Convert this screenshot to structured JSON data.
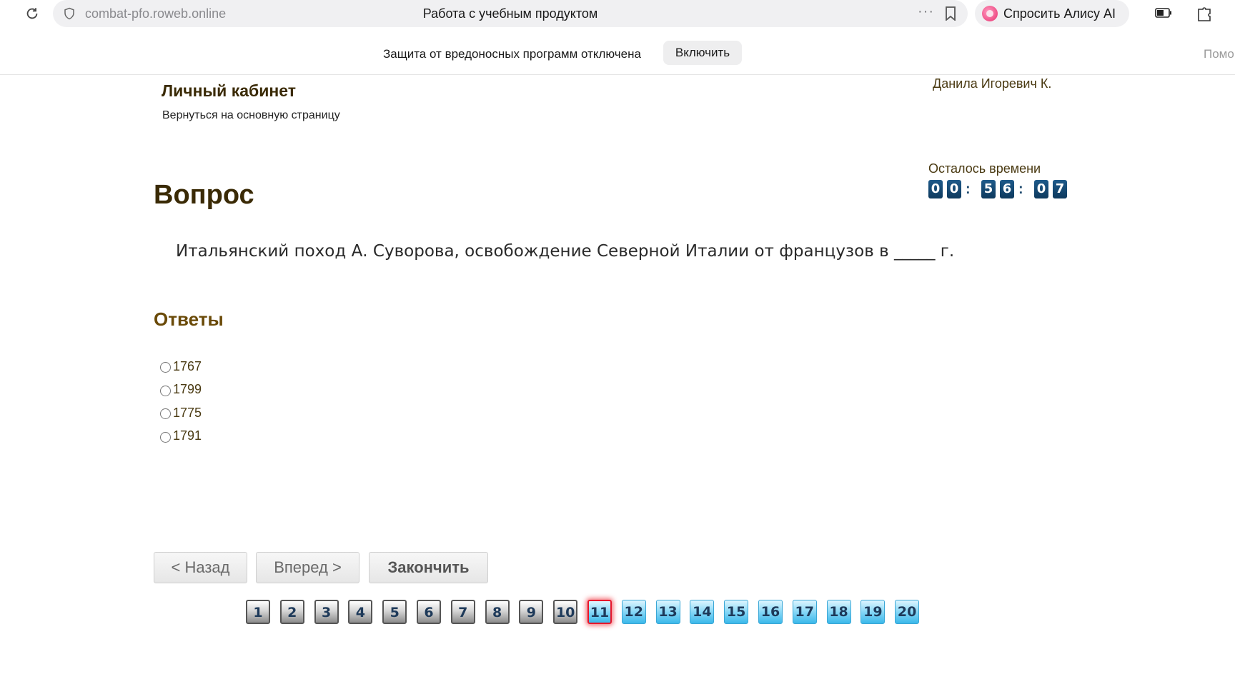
{
  "browser": {
    "url": "combat-pfo.roweb.online",
    "page_title": "Работа с учебным продуктом",
    "more": "···",
    "alice_label": "Спросить Алису AI"
  },
  "banner": {
    "message": "Защита от вредоносных программ отключена",
    "enable_label": "Включить",
    "help_label": "Помо"
  },
  "header": {
    "cabinet_title": "Личный кабинет",
    "back_link": "Вернуться на основную страницу",
    "user_name": "Данила Игоревич К."
  },
  "timer": {
    "label": "Осталось времени",
    "digits": [
      "0",
      "0",
      "5",
      "6",
      "0",
      "7"
    ],
    "separator": ":"
  },
  "question": {
    "heading": "Вопрос",
    "text": "Итальянский поход А. Суворова, освобождение Северной Италии от французов в _____ г."
  },
  "answers": {
    "heading": "Ответы",
    "options": [
      "1767",
      "1799",
      "1775",
      "1791"
    ]
  },
  "navigation": {
    "back_label": "< Назад",
    "next_label": "Вперед >",
    "finish_label": "Закончить"
  },
  "pagination": {
    "pages": [
      "1",
      "2",
      "3",
      "4",
      "5",
      "6",
      "7",
      "8",
      "9",
      "10",
      "11",
      "12",
      "13",
      "14",
      "15",
      "16",
      "17",
      "18",
      "19",
      "20"
    ],
    "current": "11"
  },
  "colors": {
    "heading": "#3a2a05",
    "answers_heading": "#6a4a08",
    "timer_digit_bg": "#1e5a8a",
    "page_done": "#8c8c8c",
    "page_todo": "#7fd4f5",
    "page_current_border": "#e8152a"
  }
}
